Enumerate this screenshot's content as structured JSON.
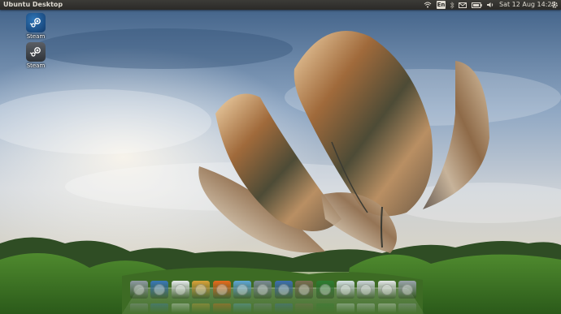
{
  "panel": {
    "title": "Ubuntu Desktop",
    "keyboard_layout": "En",
    "clock": "Sat 12 Aug 14:27",
    "indicators": [
      "wifi-icon",
      "keyboard-icon",
      "bluetooth-icon",
      "mail-icon",
      "battery-icon",
      "volume-icon",
      "clock",
      "session-gear-icon"
    ]
  },
  "desktop": {
    "icons": [
      {
        "label": "Steam",
        "icon": "steam-icon"
      },
      {
        "label": "Steam",
        "icon": "steam-icon"
      }
    ]
  },
  "dock": {
    "items": [
      {
        "icon": "home-folder-icon",
        "color": "#8f9aa3"
      },
      {
        "icon": "desktop-icon",
        "color": "#3a78b8"
      },
      {
        "icon": "calendar-icon",
        "color": "#e8ebee"
      },
      {
        "icon": "media-icon",
        "color": "#d9a23a"
      },
      {
        "icon": "firefox-icon",
        "color": "#e66a1d"
      },
      {
        "icon": "browser-icon",
        "color": "#5fa6d6"
      },
      {
        "icon": "settings-icon",
        "color": "#7b8a96"
      },
      {
        "icon": "web-icon",
        "color": "#3f6fb0"
      },
      {
        "icon": "gimp-icon",
        "color": "#7d6e53"
      },
      {
        "icon": "system-monitor-icon",
        "color": "#2e7d32"
      },
      {
        "icon": "terminal-icon",
        "color": "#d6e2e6"
      },
      {
        "icon": "screenshot-icon",
        "color": "#cfd6dc"
      },
      {
        "icon": "network-icon",
        "color": "#e4e7e9"
      },
      {
        "icon": "trash-icon",
        "color": "#9aa4ab"
      }
    ]
  }
}
